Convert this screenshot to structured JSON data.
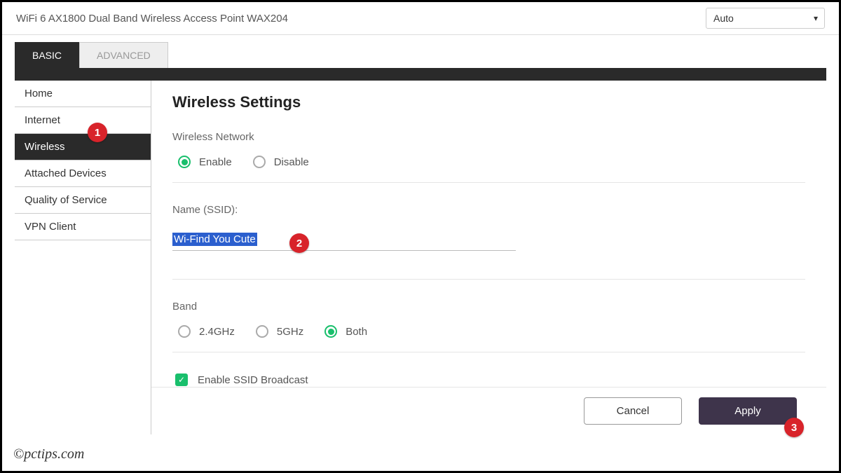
{
  "header": {
    "title": "WiFi 6 AX1800 Dual Band Wireless Access Point WAX204",
    "lang": "Auto"
  },
  "tabs": {
    "basic": "BASIC",
    "advanced": "ADVANCED"
  },
  "sidebar": {
    "items": [
      {
        "label": "Home"
      },
      {
        "label": "Internet"
      },
      {
        "label": "Wireless"
      },
      {
        "label": "Attached Devices"
      },
      {
        "label": "Quality of Service"
      },
      {
        "label": "VPN Client"
      }
    ]
  },
  "main": {
    "title": "Wireless Settings",
    "wireless_network_label": "Wireless Network",
    "enable": "Enable",
    "disable": "Disable",
    "ssid_label": "Name (SSID):",
    "ssid_value": "Wi-Find You Cute",
    "band_label": "Band",
    "band24": "2.4GHz",
    "band5": "5GHz",
    "band_both": "Both",
    "broadcast_label": "Enable SSID Broadcast"
  },
  "buttons": {
    "cancel": "Cancel",
    "apply": "Apply"
  },
  "markers": {
    "one": "1",
    "two": "2",
    "three": "3"
  },
  "watermark": "©pctips.com"
}
